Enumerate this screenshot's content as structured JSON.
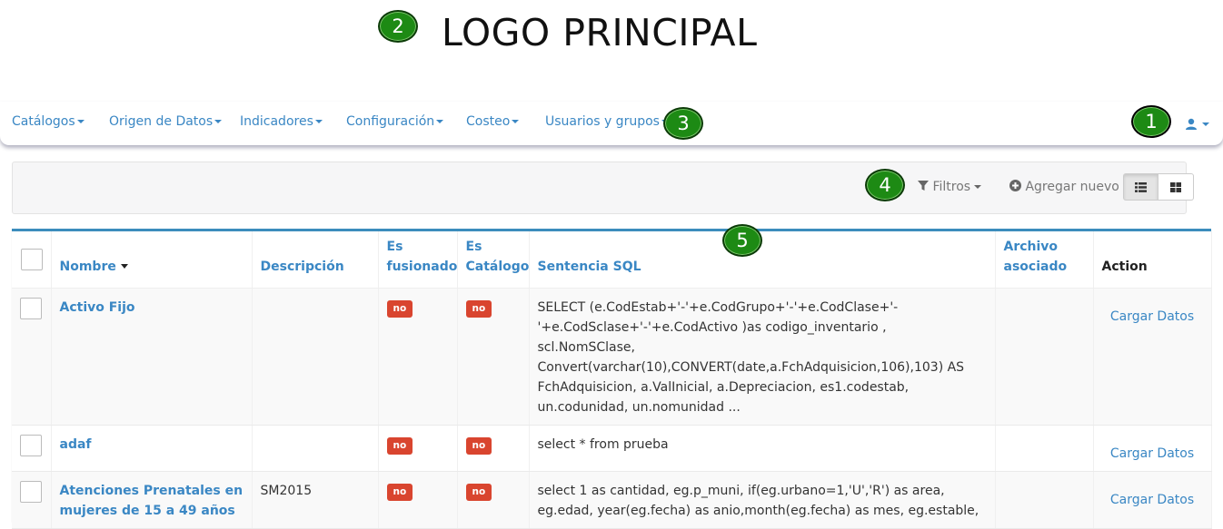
{
  "header": {
    "logo_text": "LOGO PRINCIPAL",
    "badges": {
      "b1": "1",
      "b2": "2",
      "b3": "3",
      "b4": "4",
      "b5": "5"
    }
  },
  "nav": {
    "items": [
      {
        "label": "Catálogos"
      },
      {
        "label": "Origen de Datos"
      },
      {
        "label": "Indicadores"
      },
      {
        "label": "Configuración"
      },
      {
        "label": "Costeo"
      },
      {
        "label": "Usuarios y grupos"
      }
    ],
    "user_icon": "user-icon"
  },
  "toolbar": {
    "filters_label": "Filtros",
    "add_new_label": "Agregar nuevo",
    "list_view_icon": "list-icon",
    "grid_view_icon": "grid-icon"
  },
  "table": {
    "headers": {
      "nombre": "Nombre",
      "descripcion": "Descripción",
      "es_fusionado": "Es fusionado",
      "es_catalogo": "Es Catálogo",
      "sentencia": "Sentencia SQL",
      "archivo": "Archivo asociado",
      "action": "Action"
    },
    "rows": [
      {
        "nombre": "Activo Fijo",
        "descripcion": "",
        "es_fusionado": "no",
        "es_catalogo": "no",
        "sentencia": "SELECT (e.CodEstab+'-'+e.CodGrupo+'-'+e.CodClase+'-'+e.CodSclase+'-'+e.CodActivo )as codigo_inventario , scl.NomSClase, Convert(varchar(10),CONVERT(date,a.FchAdquisicion,106),103) AS FchAdquisicion, a.ValInicial, a.Depreciacion, es1.codestab, un.codunidad, un.nomunidad ...",
        "archivo": "",
        "action": "Cargar Datos"
      },
      {
        "nombre": "adaf",
        "descripcion": "",
        "es_fusionado": "no",
        "es_catalogo": "no",
        "sentencia": "select * from prueba",
        "archivo": "",
        "action": "Cargar Datos"
      },
      {
        "nombre": "Atenciones Prenatales en mujeres de 15 a 49 años",
        "descripcion": "SM2015",
        "es_fusionado": "no",
        "es_catalogo": "no",
        "sentencia": "select 1 as cantidad, eg.p_muni, if(eg.urbano=1,'U','R') as area, eg.edad, year(eg.fecha) as anio,month(eg.fecha) as mes, eg.estable,",
        "archivo": "",
        "action": "Cargar Datos"
      }
    ]
  },
  "colors": {
    "accent": "#3a87c4",
    "badge_green": "#1d8a14",
    "label_red": "#d9452f",
    "panel_border": "#3c8dbc"
  }
}
